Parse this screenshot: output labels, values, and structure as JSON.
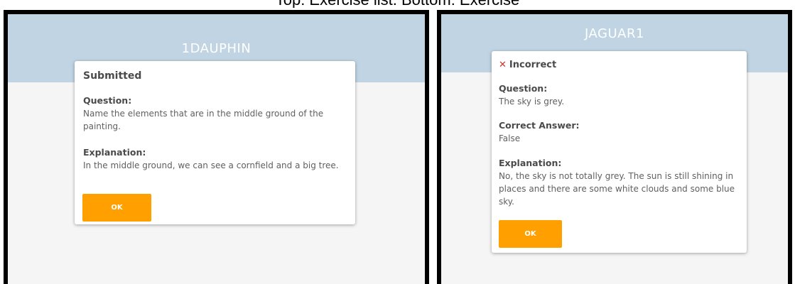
{
  "caption": "Top: Exercise list. Bottom: Exercise",
  "left_panel": {
    "header_title": "1DAUPHIN",
    "dialog": {
      "title": "Submitted",
      "question_label": "Question:",
      "question_text": "Name the elements that are in the middle ground of the painting.",
      "explanation_label": "Explanation:",
      "explanation_text": "In the middle ground, we can see a cornfield and a big tree.",
      "ok_label": "OK"
    }
  },
  "right_panel": {
    "header_title": "JAGUAR1",
    "dialog": {
      "status_icon": "x-icon",
      "title": "Incorrect",
      "question_label": "Question:",
      "question_text": "The sky is grey.",
      "correct_answer_label": "Correct Answer:",
      "correct_answer_text": "False",
      "explanation_label": "Explanation:",
      "explanation_text": "No, the sky is not totally grey. The sun is still shining in places and there are some white clouds and some blue sky.",
      "ok_label": "OK"
    }
  },
  "colors": {
    "header_band": "#c0d4e3",
    "ok_button": "#ffa000",
    "incorrect_icon": "#d32f2f",
    "panel_border": "#000000"
  }
}
